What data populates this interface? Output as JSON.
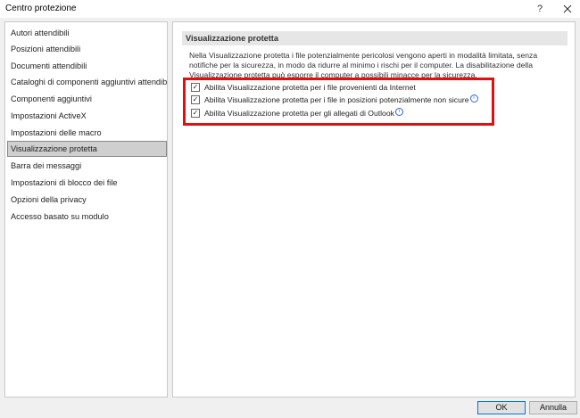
{
  "window": {
    "title": "Centro protezione",
    "help_label": "?",
    "close_icon": "close-icon"
  },
  "nav": {
    "items": [
      {
        "label": "Autori attendibili"
      },
      {
        "label": "Posizioni attendibili"
      },
      {
        "label": "Documenti attendibili"
      },
      {
        "label": "Cataloghi di componenti aggiuntivi attendibili"
      },
      {
        "label": "Componenti aggiuntivi"
      },
      {
        "label": "Impostazioni ActiveX"
      },
      {
        "label": "Impostazioni delle macro"
      },
      {
        "label": "Visualizzazione protetta",
        "selected": true
      },
      {
        "label": "Barra dei messaggi"
      },
      {
        "label": "Impostazioni di blocco dei file"
      },
      {
        "label": "Opzioni della privacy"
      },
      {
        "label": "Accesso basato su modulo"
      }
    ]
  },
  "content": {
    "header": "Visualizzazione protetta",
    "description": "Nella Visualizzazione protetta i file potenzialmente pericolosi vengono aperti in modalità limitata, senza notifiche per la sicurezza, in modo da ridurre al minimo i rischi per il computer. La disabilitazione della Visualizzazione protetta può esporre il computer a possibili minacce per la sicurezza.",
    "options": [
      {
        "label": "Abilita Visualizzazione protetta per i file provenienti da Internet",
        "checked": true,
        "info": false
      },
      {
        "label": "Abilita Visualizzazione protetta per i file in posizioni potenzialmente non sicure",
        "checked": true,
        "info": true
      },
      {
        "label": "Abilita Visualizzazione protetta per gli allegati di Outlook",
        "checked": true,
        "info": true
      }
    ],
    "highlight_color": "#e01010"
  },
  "buttons": {
    "ok": "OK",
    "cancel": "Annulla"
  }
}
